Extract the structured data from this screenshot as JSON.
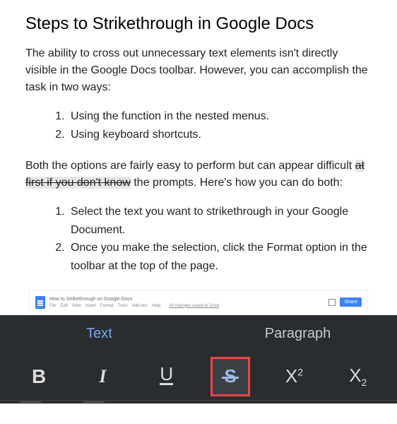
{
  "article": {
    "heading": "Steps to Strikethrough in Google Docs",
    "intro": "The ability to cross out unnecessary text elements isn't directly visible in the Google Docs toolbar. However, you can accomplish the task in two ways:",
    "ways": [
      "Using the function in the nested menus.",
      "Using keyboard shortcuts."
    ],
    "para2_before": "Both the options are fairly easy to perform but can appear difficult ",
    "para2_strike": "at first if you don't know",
    "para2_after": " the prompts. Here's how you can do both:",
    "steps": [
      "Select the text you want to strikethrough in your Google Document.",
      "Once you make the selection, click the Format option in the toolbar at the top of the page."
    ]
  },
  "mini_doc": {
    "title": "How to Strikethrough on Google Docs",
    "menu": [
      "File",
      "Edit",
      "View",
      "Insert",
      "Format",
      "Tools",
      "Add-ons",
      "Help"
    ],
    "saved": "All changes saved in Drive",
    "share": "Share"
  },
  "format_bar": {
    "tab_text": "Text",
    "tab_paragraph": "Paragraph",
    "bold": "B",
    "italic": "I",
    "underline": "U",
    "strike": "S",
    "super_base": "X",
    "super_exp": "2",
    "sub_base": "X",
    "sub_exp": "2"
  }
}
